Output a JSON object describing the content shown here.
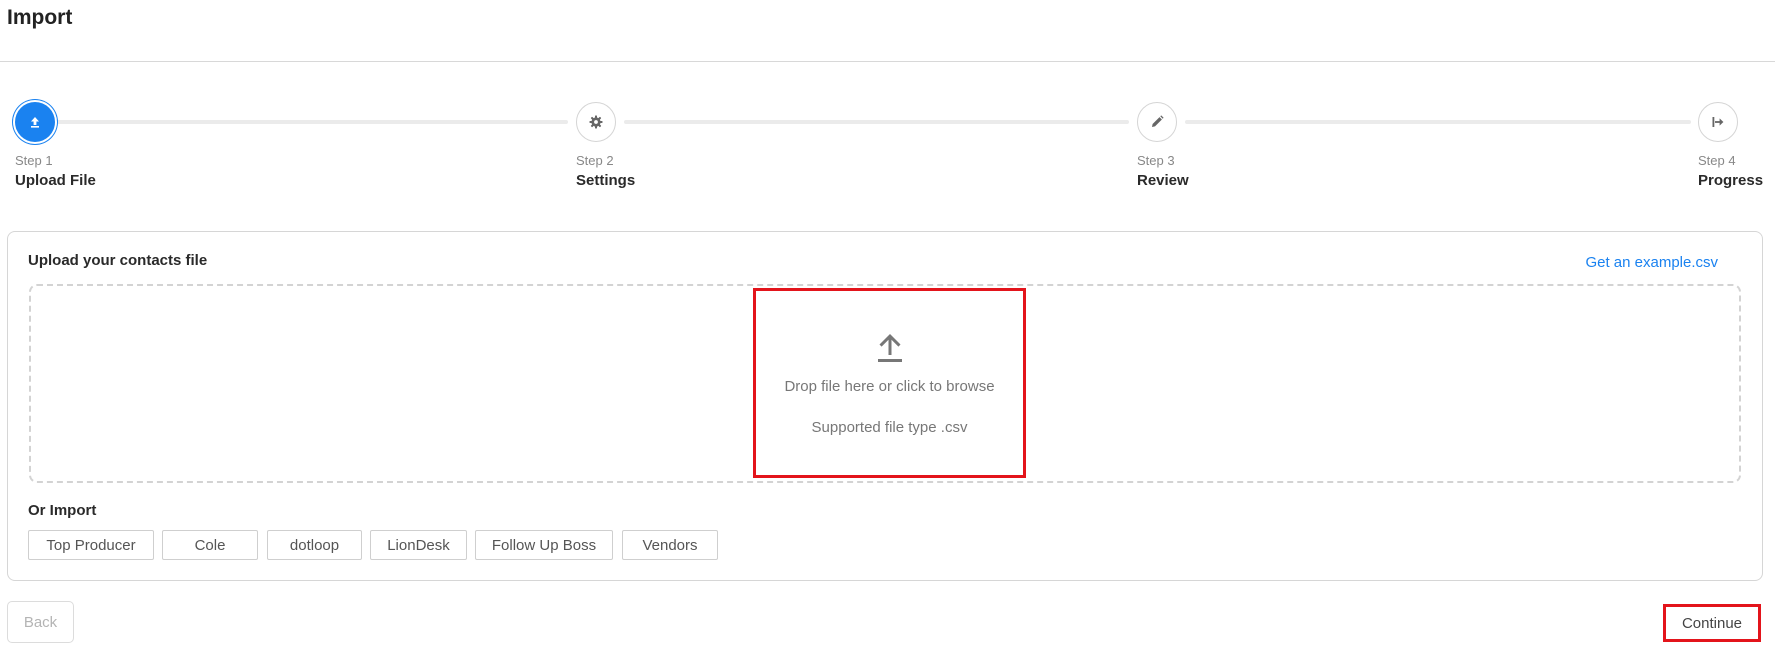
{
  "page": {
    "title": "Import"
  },
  "stepper": {
    "steps": [
      {
        "number": "Step 1",
        "title": "Upload File",
        "icon": "upload-icon",
        "state": "active"
      },
      {
        "number": "Step 2",
        "title": "Settings",
        "icon": "gear-icon",
        "state": "pending"
      },
      {
        "number": "Step 3",
        "title": "Review",
        "icon": "pencil-icon",
        "state": "pending"
      },
      {
        "number": "Step 4",
        "title": "Progress",
        "icon": "arrow-right-to-bar-icon",
        "state": "pending"
      }
    ]
  },
  "upload_card": {
    "title": "Upload your contacts file",
    "example_link": "Get an example.csv",
    "dropzone": {
      "icon": "upload-arrow-icon",
      "text": "Drop file here or click to browse",
      "support": "Supported file type .csv"
    },
    "or_import_label": "Or Import",
    "vendors": [
      "Top Producer",
      "Cole",
      "dotloop",
      "LionDesk",
      "Follow Up Boss",
      "Vendors"
    ]
  },
  "footer": {
    "back_label": "Back",
    "continue_label": "Continue"
  },
  "colors": {
    "accent": "#1a82f0",
    "highlight": "#e3141b"
  }
}
